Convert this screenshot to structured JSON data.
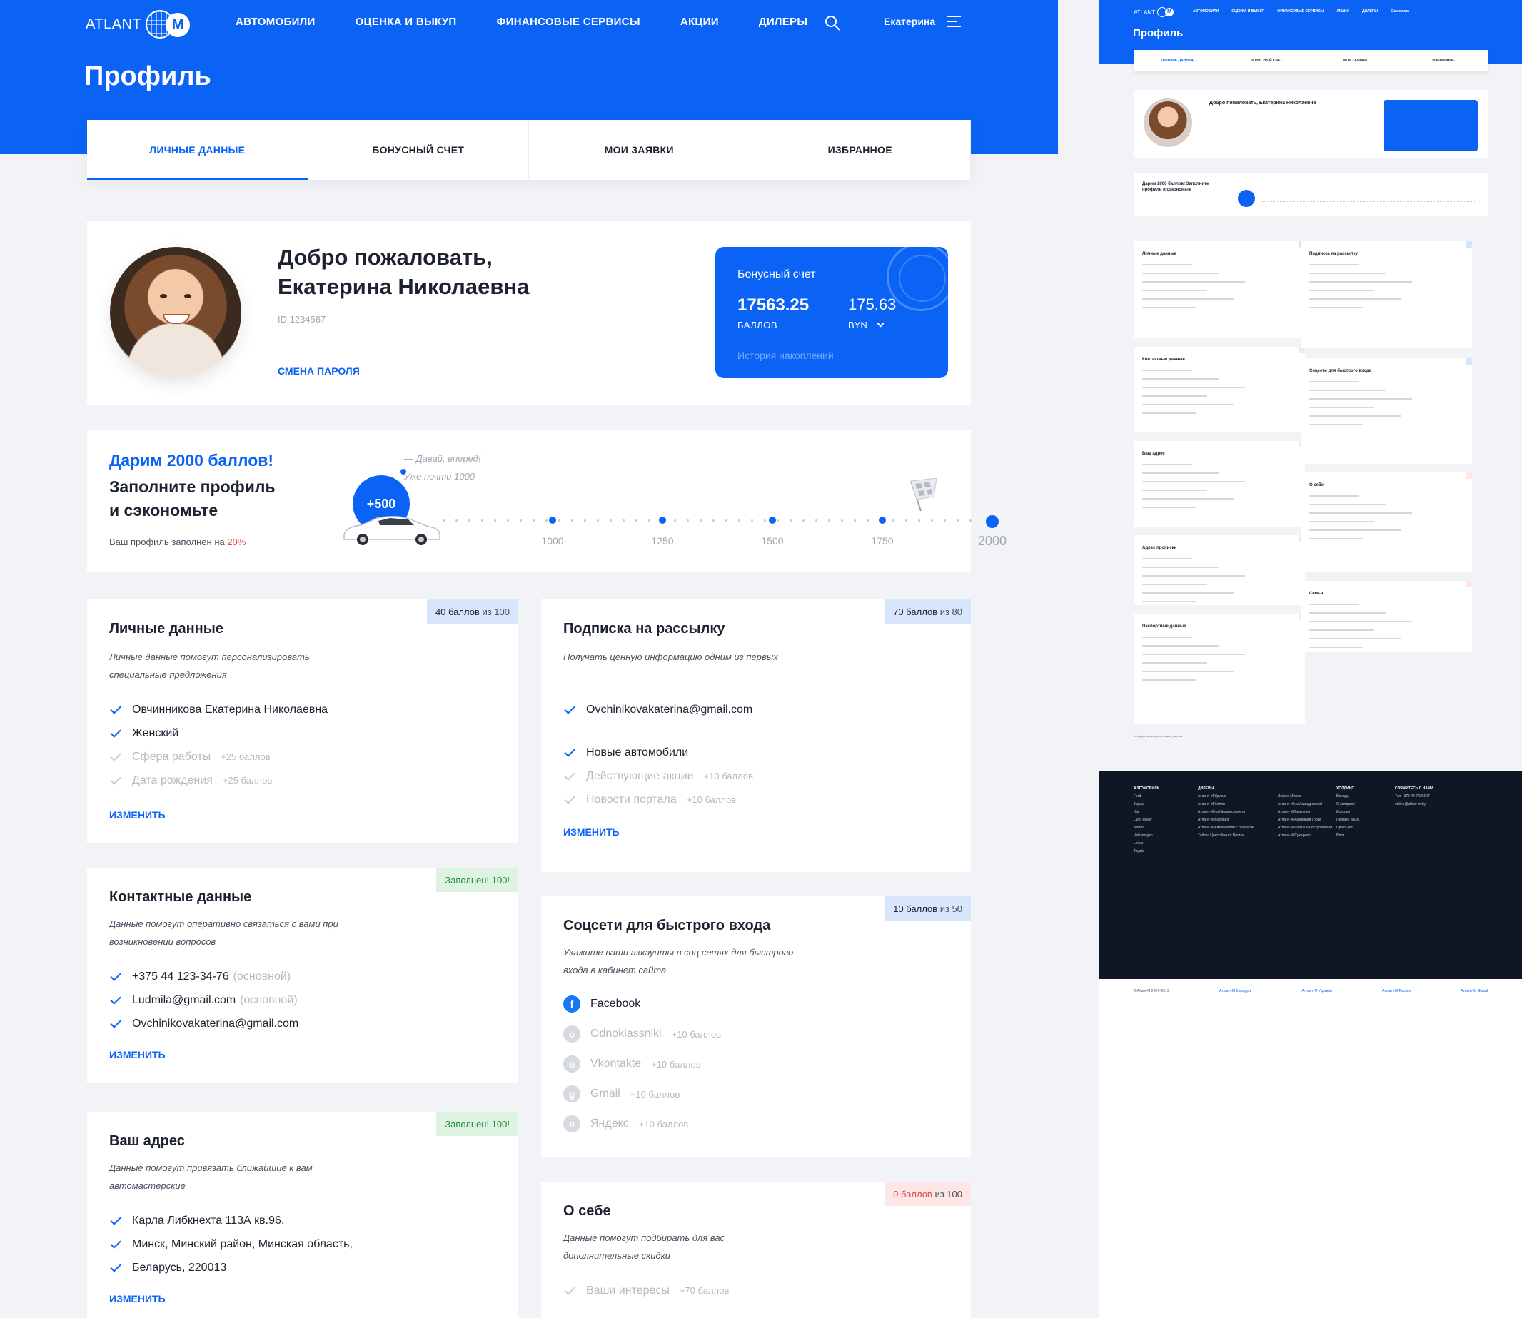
{
  "brand": {
    "logo_text": "ATLANT",
    "logo_letter": "M"
  },
  "nav": {
    "items": [
      "АВТОМОБИЛИ",
      "ОЦЕНКА И ВЫКУП",
      "ФИНАНСОВЫЕ СЕРВИСЫ",
      "АКЦИИ",
      "ДИЛЕРЫ"
    ],
    "user_name": "Екатерина"
  },
  "page": {
    "title": "Профиль"
  },
  "tabs": [
    "ЛИЧНЫЕ ДАННЫЕ",
    "БОНУСНЫЙ СЧЕТ",
    "МОИ ЗАЯВКИ",
    "ИЗБРАННОЕ"
  ],
  "welcome": {
    "greeting_line1": "Добро пожаловать,",
    "greeting_line2": "Екатерина Николаевна",
    "id": "ID 1234567",
    "change_password": "СМЕНА ПАРОЛЯ"
  },
  "bonus": {
    "label": "Бонусный счет",
    "points": "17563.25",
    "points_unit": "БАЛЛОВ",
    "money": "175.63",
    "money_unit": "BYN",
    "history": "История накоплений"
  },
  "promo": {
    "headline": "Дарим 2000 баллов!",
    "sub_line1": "Заполните профиль",
    "sub_line2": "и сэкономьте",
    "fill_text": "Ваш профиль заполнен на ",
    "fill_value": "20%",
    "note_line1": "— Давай, вперед!",
    "note_line2": "Уже почти 1000",
    "bubble": "+500",
    "milestones": [
      "1000",
      "1250",
      "1500",
      "1750",
      "2000"
    ],
    "progress_percent": 20
  },
  "cards": {
    "personal": {
      "title": "Личные данные",
      "desc": "Личные данные помогут персонализировать специальные предложения",
      "badge_value": "40 баллов",
      "badge_rest": "из 100",
      "items": [
        {
          "text": "Овчинникова Екатерина Николаевна",
          "done": true,
          "pts": ""
        },
        {
          "text": "Женский",
          "done": true,
          "pts": ""
        },
        {
          "text": "Сфера работы",
          "done": false,
          "pts": "+25 баллов"
        },
        {
          "text": "Дата рождения",
          "done": false,
          "pts": "+25 баллов"
        }
      ],
      "edit": "ИЗМЕНИТЬ"
    },
    "subscribe": {
      "title": "Подписка на рассылку",
      "desc": "Получать ценную информацию одним из первых",
      "badge_value": "70 баллов",
      "badge_rest": "из 80",
      "email": "Ovchinikovakaterina@gmail.com",
      "items": [
        {
          "text": "Новые автомобили",
          "done": true,
          "pts": ""
        },
        {
          "text": "Действующие акции",
          "done": false,
          "pts": "+10 баллов"
        },
        {
          "text": "Новости портала",
          "done": false,
          "pts": "+10 баллов"
        }
      ],
      "edit": "ИЗМЕНИТЬ"
    },
    "contacts": {
      "title": "Контактные данные",
      "desc": "Данные помогут оперативно связаться с вами при возникновении вопросов",
      "badge": "Заполнен! 100!",
      "items": [
        {
          "text": "+375 44 123-34-76",
          "note": "(основной)"
        },
        {
          "text": "Ludmila@gmail.com",
          "note": "(основной)"
        },
        {
          "text": "Ovchinikovakaterina@gmail.com",
          "note": ""
        }
      ],
      "edit": "ИЗМЕНИТЬ"
    },
    "social": {
      "title": "Соцсети для быстрого входа",
      "desc": "Укажите ваши аккаунты в соц сетях для быстрого входа в кабинет сайта",
      "badge_value": "10 баллов",
      "badge_rest": "из 50",
      "items": [
        {
          "text": "Facebook",
          "pts": "",
          "icon": "f",
          "color": "#1877f2",
          "done": true
        },
        {
          "text": "Odnoklassniki",
          "pts": "+10 баллов",
          "icon": "о",
          "color": "#d6d9df",
          "done": false
        },
        {
          "text": "Vkontakte",
          "pts": "+10 баллов",
          "icon": "в",
          "color": "#d6d9df",
          "done": false
        },
        {
          "text": "Gmail",
          "pts": "+10 баллов",
          "icon": "g",
          "color": "#d6d9df",
          "done": false
        },
        {
          "text": "Яндекс",
          "pts": "+10 баллов",
          "icon": "я",
          "color": "#d6d9df",
          "done": false
        }
      ]
    },
    "address": {
      "title": "Ваш адрес",
      "desc": "Данные помогут привязать ближайшие  к вам автомастерские",
      "badge": "Заполнен! 100!",
      "items": [
        "Карла Либкнехта 113А кв.96,",
        "Минск, Минский район, Минская область,",
        "Беларусь, 220013"
      ],
      "edit": "ИЗМЕНИТЬ"
    },
    "about": {
      "title": "О себе",
      "desc": "Данные помогут подбирать для вас дополнительные скидки",
      "badge_value": "0 баллов",
      "badge_rest": "из 100",
      "items": [
        {
          "text": "Ваши интересы",
          "pts": "+70 баллов"
        }
      ]
    }
  },
  "colors": {
    "primary": "#0b63f6",
    "success": "#1a8c3a",
    "danger": "#e5484d"
  },
  "preview": {
    "title": "Профиль",
    "nav": [
      "АВТОМОБИЛИ",
      "ОЦЕНКА И ВЫКУП",
      "ФИНАНСОВЫЕ СЕРВИСЫ",
      "АКЦИИ",
      "ДИЛЕРЫ",
      "Екатерина"
    ],
    "tabs": [
      "ЛИЧНЫЕ ДАННЫЕ",
      "БОНУСНЫЙ СЧЕТ",
      "МОИ ЗАЯВКИ",
      "ИЗБРАННОЕ"
    ],
    "greeting": "Добро пожаловать, Екатерина Николаевна",
    "promo": "Дарим 2000 баллов! Заполните профиль и сэкономьте",
    "cards_left": [
      "Личные данные",
      "Контактные данные",
      "Ваш адрес",
      "Адрес прописки",
      "Паспортные данные"
    ],
    "cards_right": [
      "Подписка на рассылку",
      "Соцсети для быстрого входа",
      "О себе",
      "Семья"
    ],
    "privacy": "Конфиденциальность ваших данных",
    "footer_cols": [
      {
        "title": "АВТОМОБИЛИ",
        "items": [
          "Ford",
          "Jaguar",
          "Kia",
          "Land Rover",
          "Mazda",
          "Volkswagen",
          "Lexus",
          "Toyota"
        ]
      },
      {
        "title": "ДИЛЕРЫ",
        "items": [
          "Атлант-М Уручье",
          "Атлант-М Холли",
          "Атлант-М на Независимости",
          "Атлант-М Боровая",
          "Атлант-М Автомобили с пробегом",
          "Тойота Центр Минск Восток"
        ]
      },
      {
        "title": "",
        "items": [
          "Лексус-Минск",
          "Атлант-М на Аэродромной",
          "Атлант-М Британия",
          "Атлант-М Каменная Горка",
          "Атлант-М на Машиностроителей",
          "Атлант-М Сухарево"
        ]
      },
      {
        "title": "ХОЛДИНГ",
        "items": [
          "Бренды",
          "О холдинге",
          "История",
          "Первые лица",
          "Пресс-кит",
          "Блог"
        ]
      },
      {
        "title": "СВЯЖИТЕСЬ С НАМИ",
        "items": [
          "Тел +375 44 7420147",
          "online@atlant-m.by"
        ]
      }
    ],
    "bottom": [
      "© Atlant-M 2007–2019",
      "Атлант-М Беларусь",
      "Атлант-М Украина",
      "Атлант-М Россия",
      "Атлант-М Global"
    ]
  }
}
